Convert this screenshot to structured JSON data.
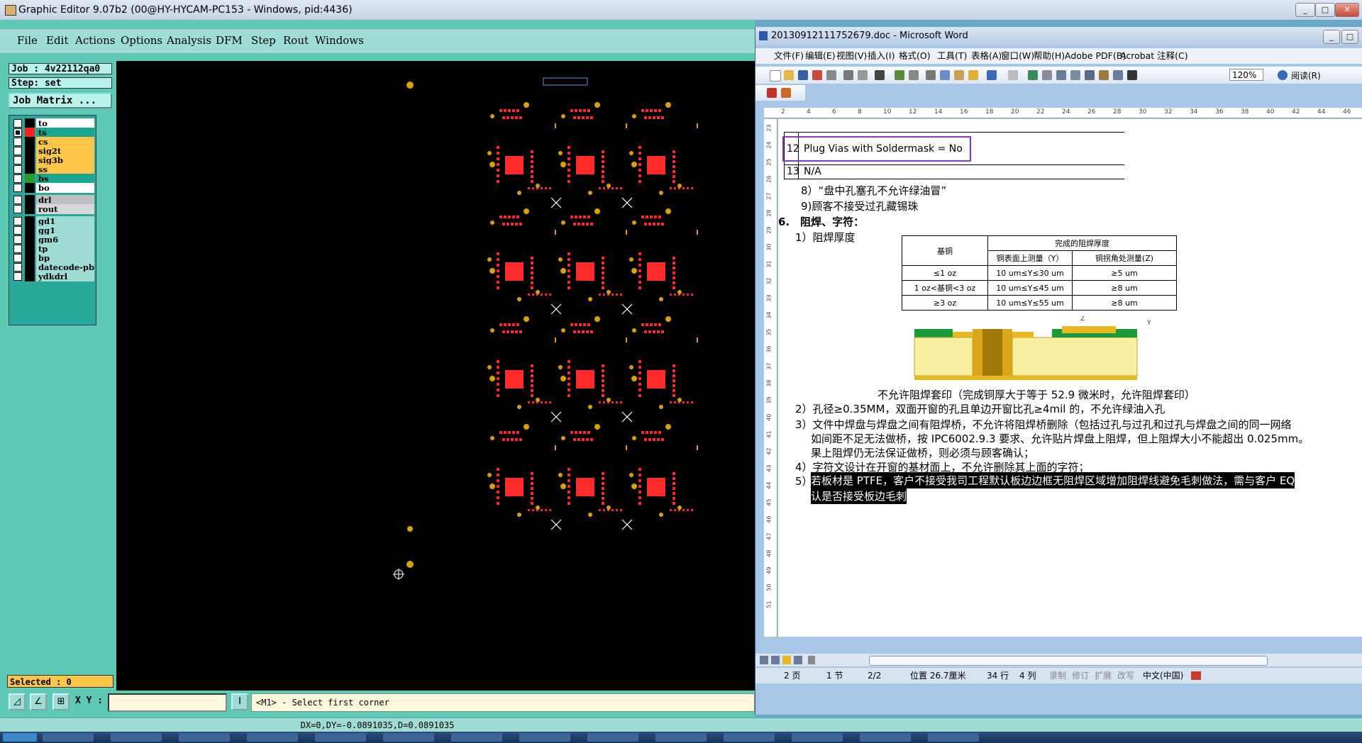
{
  "ge": {
    "title": "Graphic Editor 9.07b2 (00@HY-HYCAM-PC153 - Windows, pid:4436)",
    "menu": [
      "File",
      "Edit",
      "Actions",
      "Options",
      "Analysis",
      "DFM",
      "Step",
      "Rout",
      "Windows"
    ],
    "job": "Job : 4v22112qa0",
    "step": "Step: set",
    "job_matrix": "Job Matrix ...",
    "layers": [
      {
        "name": "to",
        "color": "#000000",
        "label_bg": "#ffffff",
        "checked": false
      },
      {
        "name": "ts",
        "color": "#ff2020",
        "label_bg": "#1aa58e",
        "checked": true
      },
      {
        "name": "cs",
        "color": "#000000",
        "label_bg": "#ffc64a",
        "checked": false
      },
      {
        "name": "sig2t",
        "color": "#000000",
        "label_bg": "#ffc64a",
        "checked": false
      },
      {
        "name": "sig3b",
        "color": "#000000",
        "label_bg": "#ffc64a",
        "checked": false
      },
      {
        "name": "ss",
        "color": "#000000",
        "label_bg": "#ffc64a",
        "checked": false
      },
      {
        "name": "bs",
        "color": "#2a9a2a",
        "label_bg": "#1aa58e",
        "checked": false
      },
      {
        "name": "bo",
        "color": "#000000",
        "label_bg": "#ffffff",
        "checked": false
      },
      {
        "name": "drl",
        "color": "#000000",
        "label_bg": "#c0c0c0",
        "checked": false
      },
      {
        "name": "rout",
        "color": "#000000",
        "label_bg": "#d8d8d8",
        "checked": false
      },
      {
        "name": "gd1",
        "color": "#000000",
        "label_bg": "#9edcd4",
        "checked": false
      },
      {
        "name": "gg1",
        "color": "#000000",
        "label_bg": "#9edcd4",
        "checked": false
      },
      {
        "name": "gm6",
        "color": "#000000",
        "label_bg": "#9edcd4",
        "checked": false
      },
      {
        "name": "tp",
        "color": "#000000",
        "label_bg": "#9edcd4",
        "checked": false
      },
      {
        "name": "bp",
        "color": "#000000",
        "label_bg": "#9edcd4",
        "checked": false
      },
      {
        "name": "datecode-pbe",
        "color": "#000000",
        "label_bg": "#9edcd4",
        "checked": false
      },
      {
        "name": "ydkdrl",
        "color": "#000000",
        "label_bg": "#9edcd4",
        "checked": false
      }
    ],
    "selected": "Selected : 0",
    "xy_label": "X Y :",
    "xy_value": "",
    "prompt": "<M1> - Select first corner",
    "coords": "DX=0,DY=-0.0891035,D=0.0891035",
    "colors": {
      "pad": "#ff2a2a",
      "via": "#d8a000",
      "cross": "#ffffff",
      "background": "#000000"
    }
  },
  "word": {
    "title": "20130912111752679.doc - Microsoft Word",
    "menu": [
      "文件(F)",
      "编辑(E)",
      "视图(V)",
      "插入(I)",
      "格式(O)",
      "工具(T)",
      "表格(A)",
      "窗口(W)",
      "帮助(H)",
      "Adobe PDF(B)",
      "Acrobat 注释(C)"
    ],
    "zoom": "120%",
    "read_label": "阅读(R)",
    "doc": {
      "row12": "12",
      "row12_text": "Plug Vias with Soldermask = No",
      "row13": "13",
      "row13_text": "N/A",
      "item8": "8）“盘中孔塞孔不允许绿油冒”",
      "item9": "9)顾客不接受过孔藏锡珠",
      "section6": "6.　阻焊、字符：",
      "sub1": "1）阻焊厚度",
      "table": {
        "col1_header": "基铜",
        "group_header": "完成的阻焊厚度",
        "col2_header": "铜表面上测量（Y）",
        "col3_header": "铜拐角处测量(Z)",
        "rows": [
          [
            "≤1 oz",
            "10 um≤Y≤30 um",
            "≥5 um"
          ],
          [
            "1 oz<基铜<3 oz",
            "10 um≤Y≤45 um",
            "≥8 um"
          ],
          [
            "≥3 oz",
            "10 um≤Y≤55 um",
            "≥8 um"
          ]
        ]
      },
      "caption": "不允许阻焊套印（完成铜厚大于等于 52.9 微米时，允许阻焊套印）",
      "p2": "2）孔径≥0.35MM，双面开窗的孔且单边开窗比孔≥4mil 的，不允许绿油入孔",
      "p3a": "3）文件中焊盘与焊盘之间有阻焊桥，不允许将阻焊桥删除（包括过孔与过孔和过孔与焊盘之间的同一网络",
      "p3b": "如间距不足无法做桥，按 IPC6002.9.3 要求、允许贴片焊盘上阻焊，但上阻焊大小不能超出 0.025mm。",
      "p3c": "果上阻焊仍无法保证做桥，则必须与顾客确认；",
      "p4": "4）字符文设计在开窗的基材面上，不允许删除其上面的字符；",
      "p5a": "若板材是 PTFE，客户不接受我司工程默认板边边框无阻焊区域增加阻焊线避免毛刺做法，需与客户 EQ",
      "p5b": "认是否接受板边毛刺",
      "p5_num": "5）"
    },
    "status": {
      "page": "2 页",
      "section": "1 节",
      "pages": "2/2",
      "position": "位置 26.7厘米",
      "line": "34 行",
      "col": "4 列",
      "rec": "录制",
      "trk": "修订",
      "ext": "扩展",
      "ovr": "改写",
      "lang": "中文(中国)"
    }
  }
}
